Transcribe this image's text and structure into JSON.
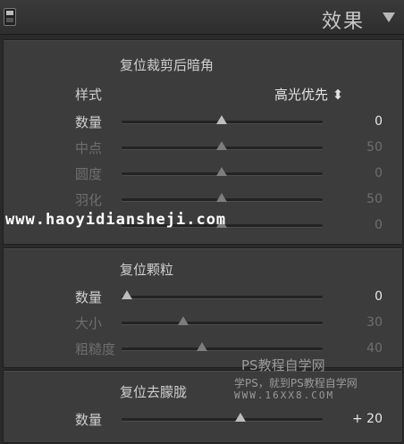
{
  "header": {
    "title": "效果"
  },
  "vignette": {
    "title": "复位裁剪后暗角",
    "style_label": "样式",
    "style_value": "高光优先 ⬍",
    "sliders": [
      {
        "label": "数量",
        "value": "0",
        "position": 0.5,
        "active": true
      },
      {
        "label": "中点",
        "value": "50",
        "position": 0.5,
        "active": false
      },
      {
        "label": "圆度",
        "value": "0",
        "position": 0.5,
        "active": false
      },
      {
        "label": "羽化",
        "value": "50",
        "position": 0.5,
        "active": false
      },
      {
        "label": "",
        "value": "0",
        "position": 0.5,
        "active": false
      }
    ]
  },
  "grain": {
    "title": "复位颗粒",
    "sliders": [
      {
        "label": "数量",
        "value": "0",
        "position": 0.0,
        "active": true
      },
      {
        "label": "大小",
        "value": "30",
        "position": 0.3,
        "active": false
      },
      {
        "label": "粗糙度",
        "value": "40",
        "position": 0.4,
        "active": false
      }
    ]
  },
  "dehaze": {
    "title": "复位去朦胧",
    "sliders": [
      {
        "label": "数量",
        "value": "+ 20",
        "position": 0.6,
        "active": true
      }
    ]
  },
  "watermarks": {
    "site_url": "www.haoyidiansheji.com",
    "ps_title": "PS教程自学网",
    "ps_subtitle": "学PS，就到PS教程自学网",
    "ps_url": "WWW.16XX8.COM"
  }
}
